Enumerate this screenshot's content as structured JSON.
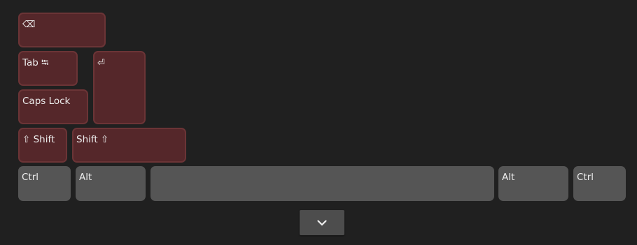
{
  "keys": {
    "backspace": {
      "label": "⌫"
    },
    "tab": {
      "label": "Tab ⭾"
    },
    "enter": {
      "label": "⏎"
    },
    "caps_lock": {
      "label": "Caps Lock"
    },
    "shift_left": {
      "label": "⇧ Shift"
    },
    "shift_right": {
      "label": "Shift ⇧"
    },
    "ctrl_left": {
      "label": "Ctrl"
    },
    "alt_left": {
      "label": "Alt"
    },
    "space": {
      "label": ""
    },
    "alt_right": {
      "label": "Alt"
    },
    "ctrl_right": {
      "label": "Ctrl"
    }
  },
  "colors": {
    "background": "#202020",
    "modifier_key_fill": "#55272a",
    "modifier_key_border": "#6b3436",
    "standard_key_fill": "#555555",
    "key_text": "#ececec",
    "collapse_button_fill": "#4d4d4d"
  },
  "collapse_button": {
    "icon": "chevron-down-icon"
  }
}
